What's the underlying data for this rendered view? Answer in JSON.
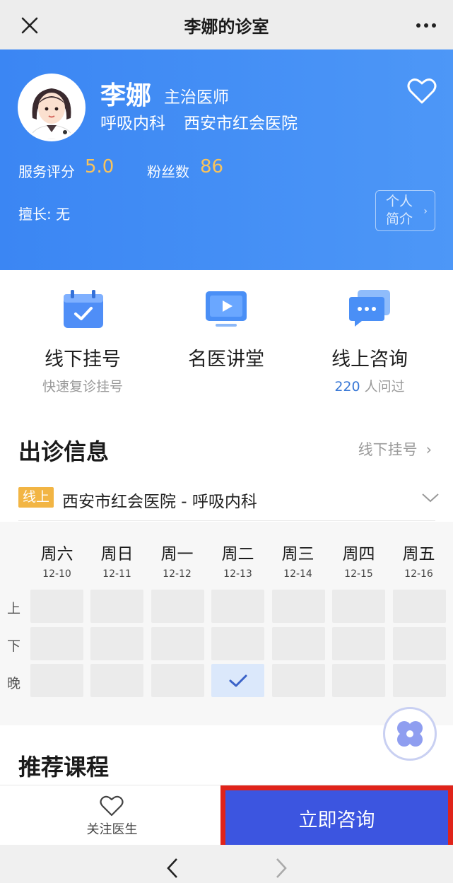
{
  "nav": {
    "title": "李娜的诊室"
  },
  "doctor": {
    "name": "李娜",
    "title": "主治医师",
    "department": "呼吸内科",
    "hospital": "西安市红会医院",
    "rating_label": "服务评分",
    "rating": "5.0",
    "fans_label": "粉丝数",
    "fans": "86",
    "expertise": "擅长: 无",
    "intro_line1": "个人",
    "intro_line2": "简介"
  },
  "services": [
    {
      "label": "线下挂号",
      "sub": "快速复诊挂号",
      "icon": "calendar-check-icon"
    },
    {
      "label": "名医讲堂",
      "sub": "",
      "icon": "video-play-icon"
    },
    {
      "label": "线上咨询",
      "sub_count": "220",
      "sub_suffix": " 人问过",
      "icon": "chat-bubble-icon"
    }
  ],
  "schedule": {
    "title": "出诊信息",
    "link": "线下挂号",
    "tag": "线上",
    "location": "西安市红会医院 - 呼吸内科",
    "days": [
      {
        "name": "周六",
        "date": "12-10"
      },
      {
        "name": "周日",
        "date": "12-11"
      },
      {
        "name": "周一",
        "date": "12-12"
      },
      {
        "name": "周二",
        "date": "12-13"
      },
      {
        "name": "周三",
        "date": "12-14"
      },
      {
        "name": "周四",
        "date": "12-15"
      },
      {
        "name": "周五",
        "date": "12-16"
      }
    ],
    "slots": [
      "上",
      "下",
      "晚"
    ],
    "available": "晚 / 周二"
  },
  "courses": {
    "title": "推荐课程"
  },
  "bottom": {
    "follow_label": "关注医生",
    "consult_label": "立即咨询"
  },
  "colors": {
    "header_blue": "#3b86f3",
    "accent_gold": "#f8c35c",
    "consult_blue": "#3c55e0",
    "highlight_red": "#e0231a"
  }
}
